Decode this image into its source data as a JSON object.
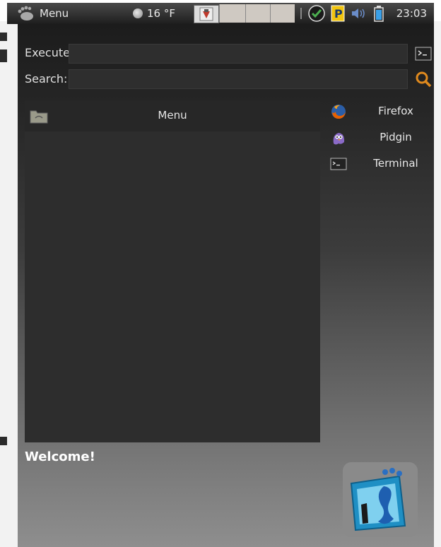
{
  "panel": {
    "menu_label": "Menu",
    "weather": "16 °F",
    "clock": "23:03"
  },
  "launcher": {
    "execute_label": "Execute",
    "search_label": "Search:",
    "execute_value": "",
    "search_value": ""
  },
  "categories": {
    "header": "Menu"
  },
  "favorites": [
    {
      "label": "Firefox",
      "icon": "firefox-icon"
    },
    {
      "label": "Pidgin",
      "icon": "pidgin-icon"
    },
    {
      "label": "Terminal",
      "icon": "terminal-icon"
    }
  ],
  "footer": {
    "welcome": "Welcome!"
  }
}
